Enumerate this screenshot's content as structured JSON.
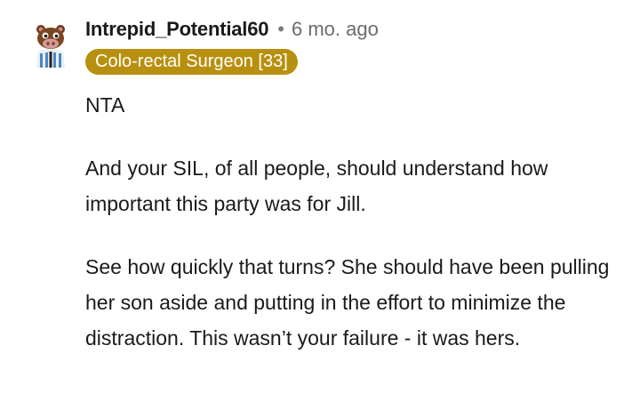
{
  "comment": {
    "author": "Intrepid_Potential60",
    "separator": "•",
    "timestamp": "6 mo. ago",
    "flair": "Colo-rectal Surgeon [33]",
    "avatar_icon": "snoo-avatar-icon",
    "flair_color": "#b8900f",
    "paragraphs": [
      "NTA",
      "And your SIL, of all people, should understand how important this party was for Jill.",
      "See how quickly that turns? She should have been pulling her son aside and putting in the effort to minimize the distraction. This wasn’t your failure - it was hers."
    ]
  }
}
